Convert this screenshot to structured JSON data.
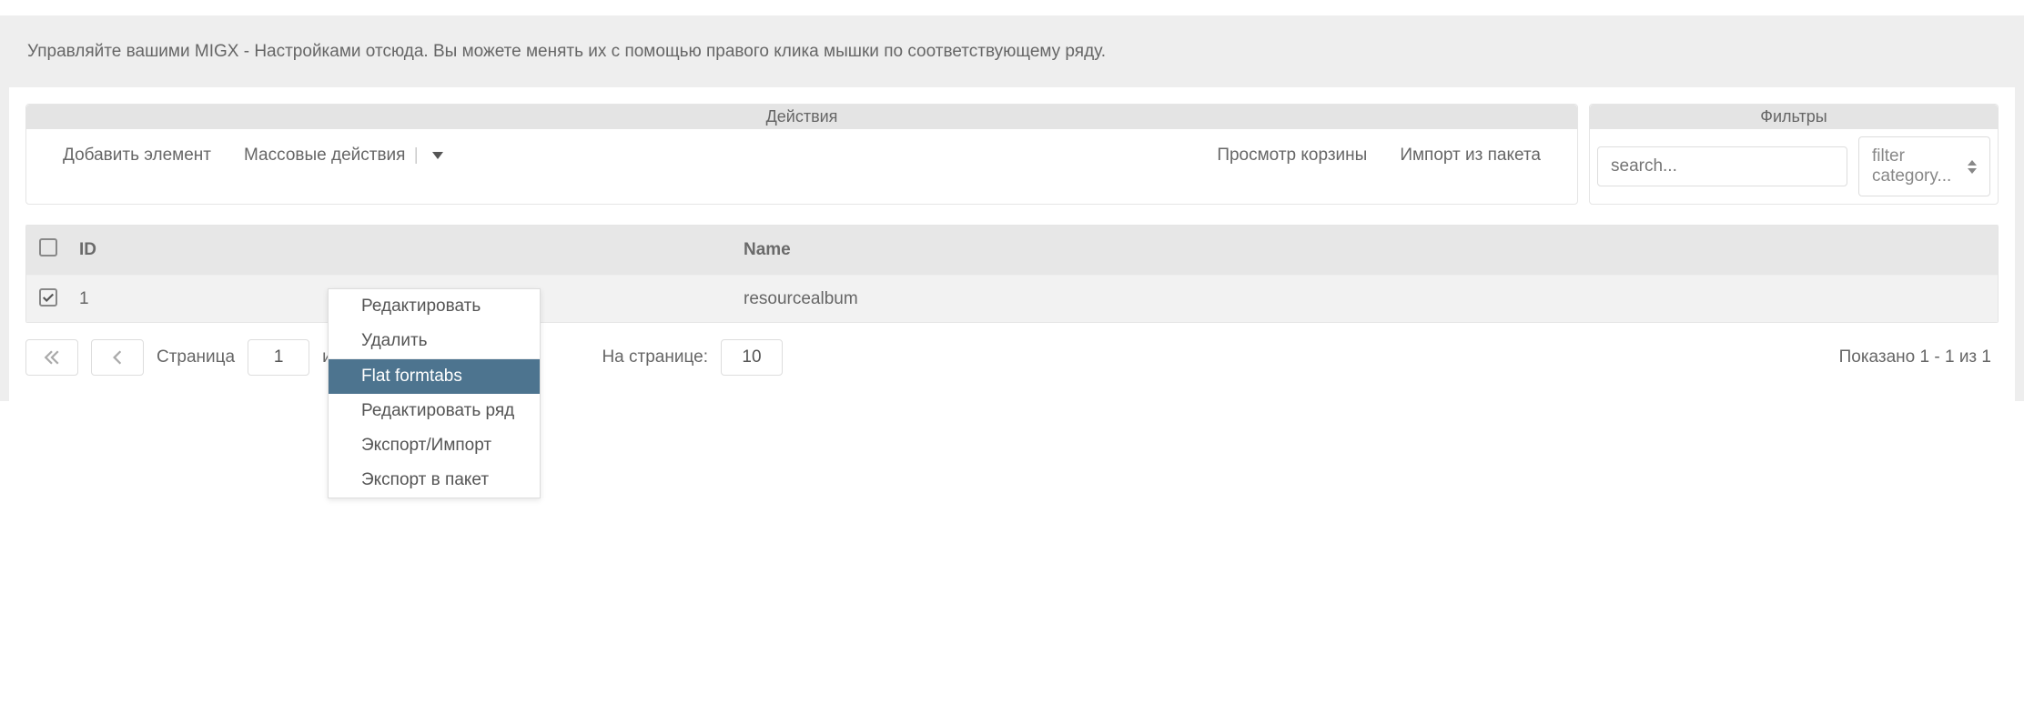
{
  "description": "Управляйте вашими MIGX - Настройками отсюда. Вы можете менять их с помощью правого клика мышки по соответствующему ряду.",
  "toolbar": {
    "actions_header": "Действия",
    "filters_header": "Фильтры",
    "add_item": "Добавить элемент",
    "bulk_actions": "Массовые действия",
    "view_trash": "Просмотр корзины",
    "import_package": "Импорт из пакета",
    "search_placeholder": "search...",
    "filter_category_placeholder": "filter category..."
  },
  "table": {
    "headers": {
      "id": "ID",
      "name": "Name"
    },
    "rows": [
      {
        "id": "1",
        "name": "resourcealbum",
        "checked": true
      }
    ]
  },
  "pager": {
    "page_label": "Страница",
    "page": "1",
    "of_label": "из",
    "per_page_label": "На странице:",
    "per_page": "10",
    "status": "Показано 1 - 1 из 1"
  },
  "context_menu": {
    "items": [
      {
        "label": "Редактировать",
        "selected": false
      },
      {
        "label": "Удалить",
        "selected": false,
        "sep_after": true
      },
      {
        "label": "Flat formtabs",
        "selected": true
      },
      {
        "label": "Редактировать ряд",
        "selected": false
      },
      {
        "label": "Экспорт/Импорт",
        "selected": false
      },
      {
        "label": "Экспорт в пакет",
        "selected": false
      }
    ]
  }
}
